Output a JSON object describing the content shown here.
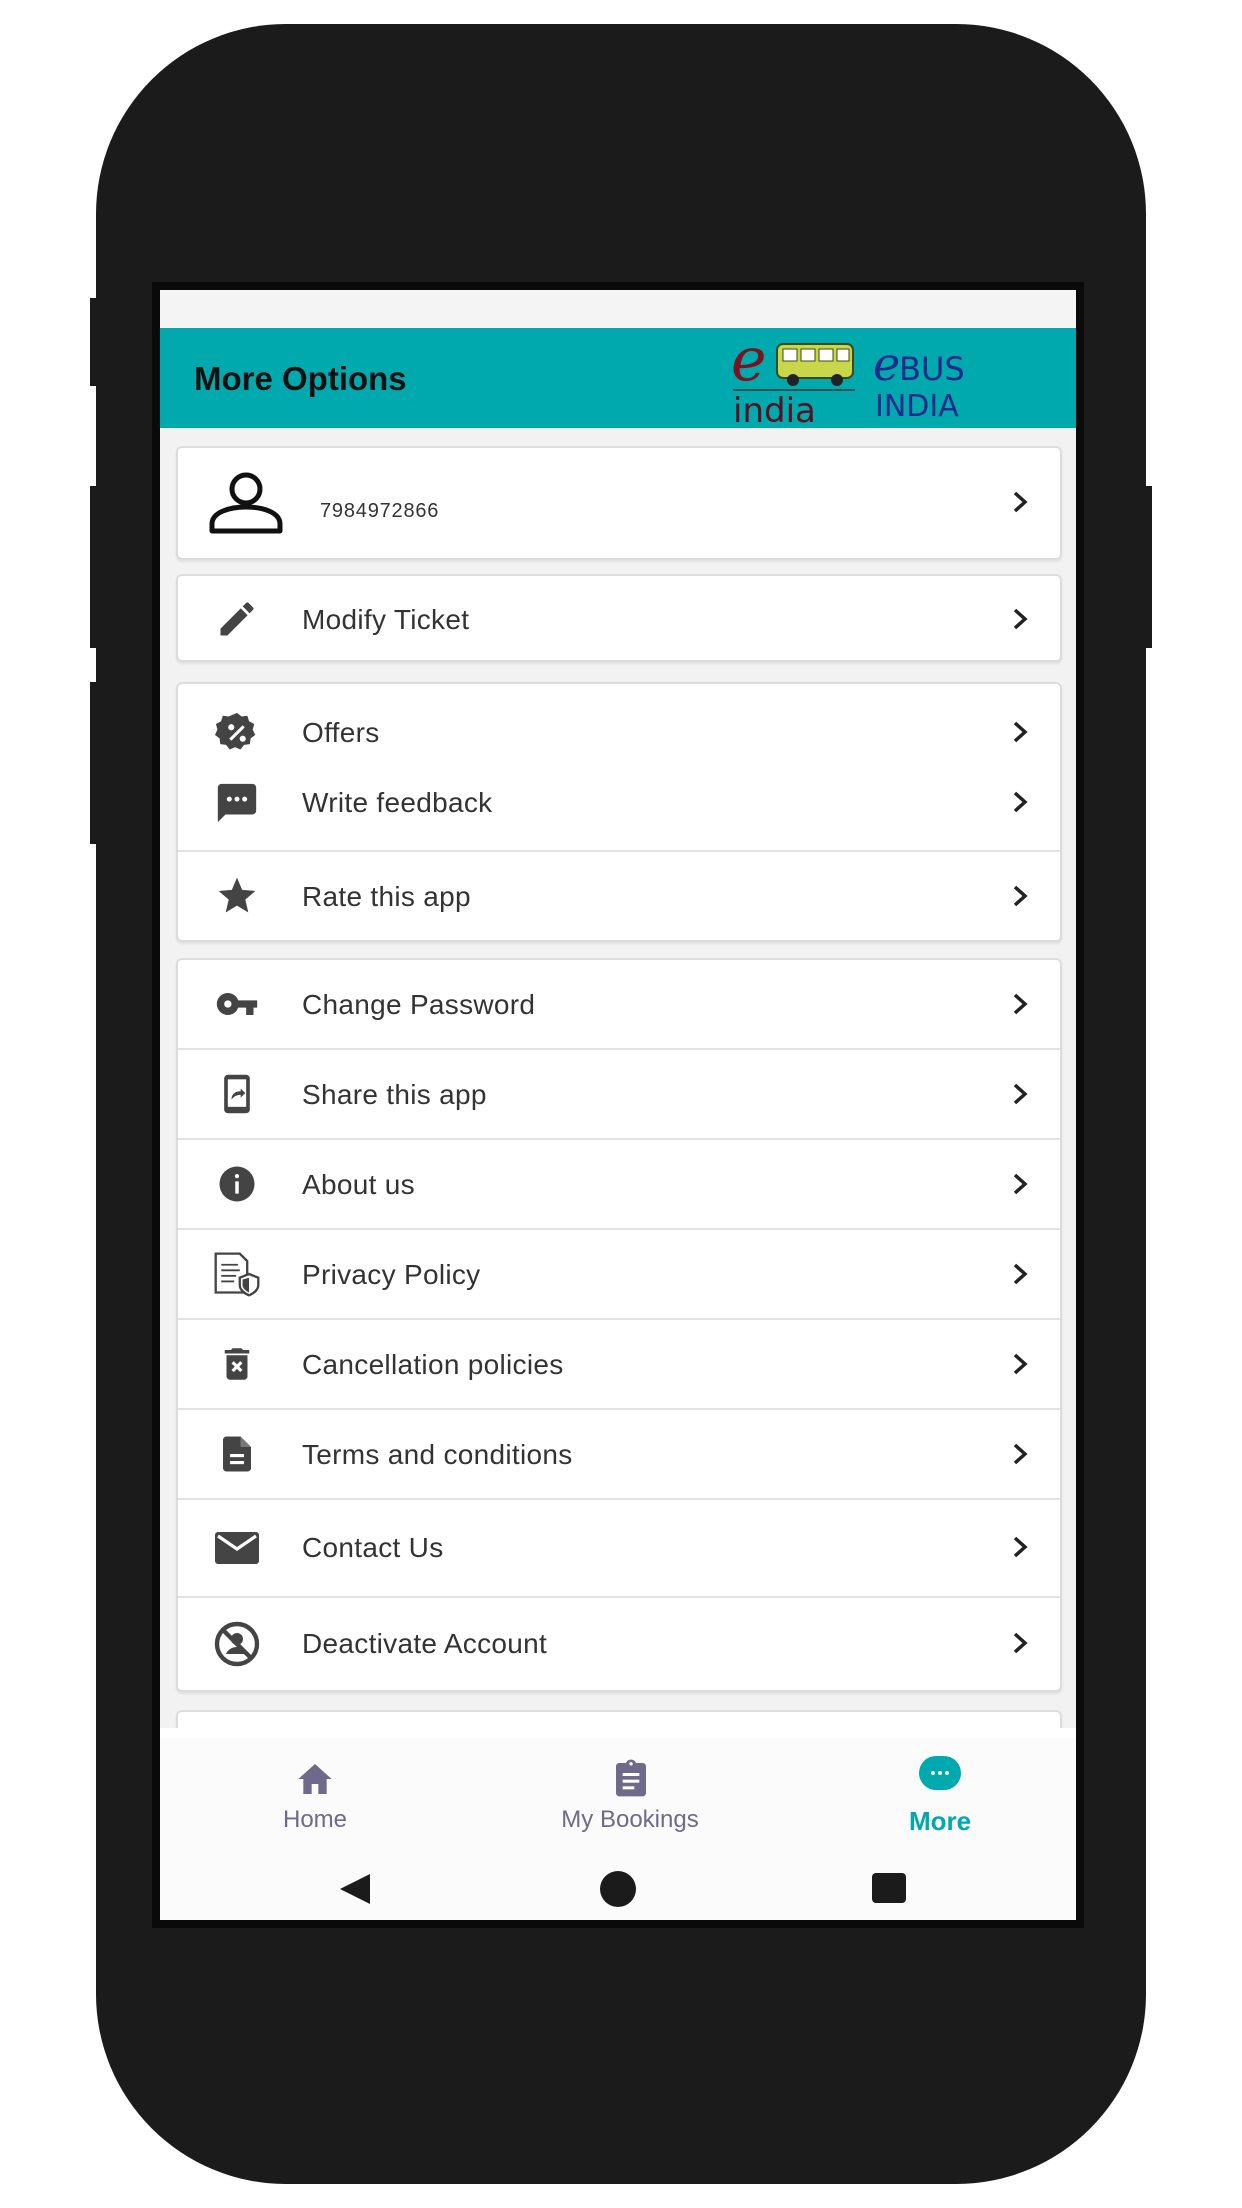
{
  "app": {
    "title": "More Options",
    "accent_color": "#00a9ad",
    "logo": {
      "left_text_top": "e",
      "left_text_bottom": "india",
      "right_text_top": "BUS",
      "right_text_prefix": "e",
      "right_text_bottom": "INDIA"
    }
  },
  "profile": {
    "icon": "person-icon",
    "phone": "7984972866"
  },
  "menu_groups": [
    {
      "items": [
        {
          "label": "Modify Ticket",
          "icon": "pencil-icon"
        }
      ]
    },
    {
      "items": [
        {
          "label": "Offers",
          "icon": "discount-badge-icon"
        },
        {
          "label": "Write feedback",
          "icon": "chat-icon"
        },
        {
          "label": "Rate this app",
          "icon": "star-icon"
        }
      ]
    },
    {
      "items": [
        {
          "label": "Change Password",
          "icon": "key-icon"
        },
        {
          "label": "Share this app",
          "icon": "share-phone-icon"
        },
        {
          "label": "About us",
          "icon": "info-icon"
        },
        {
          "label": "Privacy Policy",
          "icon": "privacy-doc-icon"
        },
        {
          "label": "Cancellation policies",
          "icon": "trash-x-icon"
        },
        {
          "label": "Terms and conditions",
          "icon": "document-icon"
        },
        {
          "label": "Contact Us",
          "icon": "mail-icon"
        },
        {
          "label": "Deactivate Account",
          "icon": "deactivate-icon"
        }
      ]
    }
  ],
  "bottom_nav": [
    {
      "label": "Home",
      "icon": "home-icon",
      "active": false
    },
    {
      "label": "My Bookings",
      "icon": "clipboard-icon",
      "active": false
    },
    {
      "label": "More",
      "icon": "more-dots-icon",
      "active": true
    }
  ],
  "colors": {
    "active_nav": "#00a9ad",
    "inactive_nav": "#6f6a8a"
  }
}
